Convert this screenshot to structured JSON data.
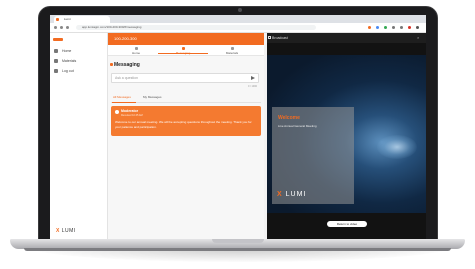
{
  "browser": {
    "tab_title": "Lumi",
    "url": "app.lumiagm.com/100-200-300/#/messaging"
  },
  "sidebar": {
    "items": [
      {
        "label": "Home"
      },
      {
        "label": "Materials"
      },
      {
        "label": "Log out"
      }
    ],
    "footer_logo_mark": "X",
    "footer_logo_text": "LUMI"
  },
  "main": {
    "meeting_id": "100-200-300",
    "subnav": [
      {
        "label": "Home"
      },
      {
        "label": "Messaging"
      },
      {
        "label": "Materials"
      }
    ],
    "messaging_title": "Messaging",
    "input_placeholder": "Ask a question",
    "char_count": "0 / 1000",
    "message_tabs": [
      {
        "label": "All Messages"
      },
      {
        "label": "My Messages"
      }
    ],
    "message_card": {
      "from": "Moderator",
      "time": "Received 10:45 AM",
      "text": "Welcome to our annual meeting. We will be accepting questions throughout the meeting. Thank you for your patience and participation."
    }
  },
  "broadcast": {
    "title": "Broadcast",
    "close_glyph": "×",
    "welcome_title": "Welcome",
    "welcome_subtitle": "Live Annual General Meeting",
    "logo_mark": "X",
    "logo_text": "LUMI",
    "return_button": "Return to video"
  },
  "colors": {
    "accent": "#f26b21",
    "broadcast_bg": "#121212"
  }
}
